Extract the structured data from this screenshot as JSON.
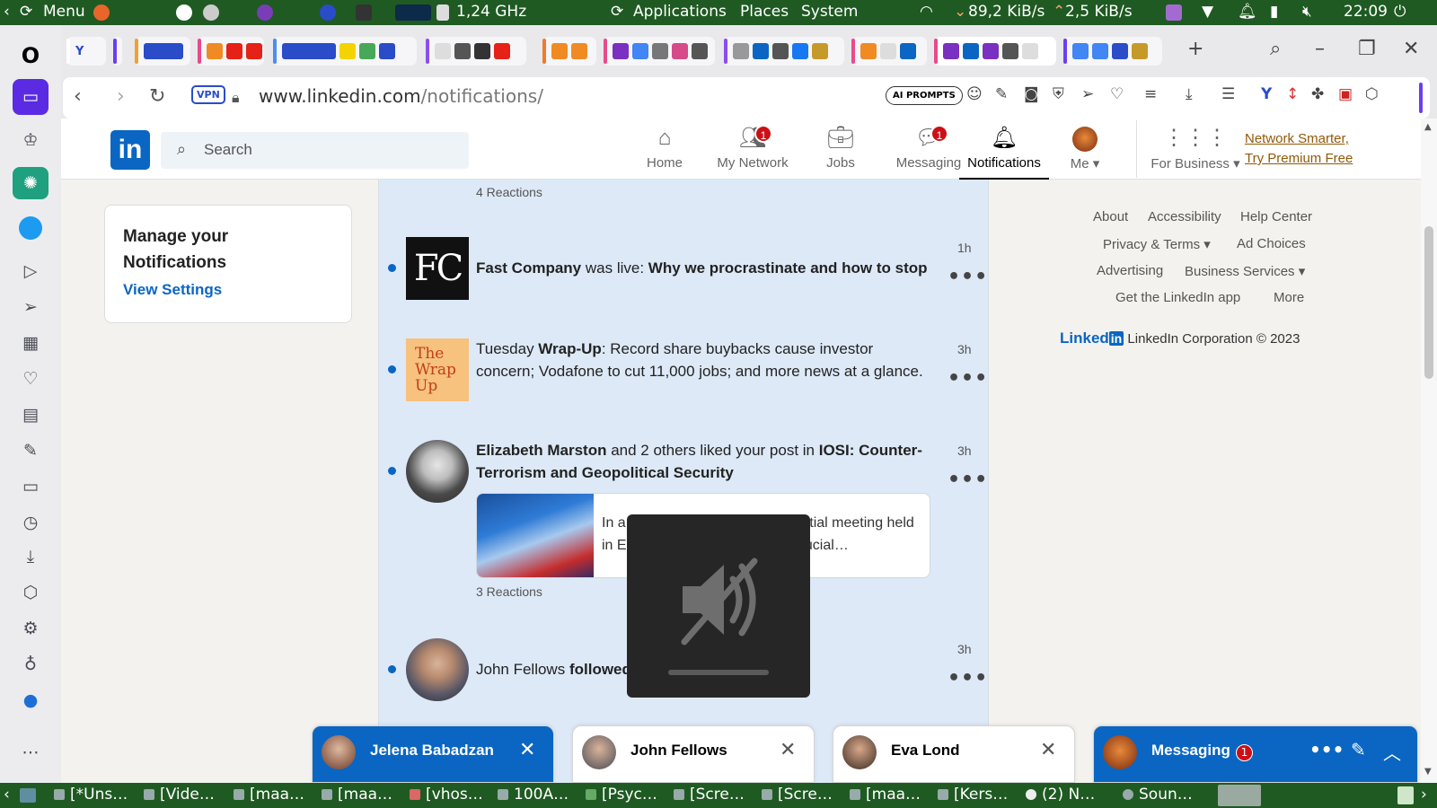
{
  "system_bar": {
    "menu_label": "Menu",
    "cpu_freq": "1,24 GHz",
    "applications": "Applications",
    "places": "Places",
    "system": "System",
    "net_down": "89,2 KiB/s",
    "net_up": "2,5 KiB/s",
    "clock": "22:09"
  },
  "browser": {
    "vpn_label": "VPN",
    "url_host": "www.linkedin.com",
    "url_path": "/notifications/",
    "ai_prompts_label": "AI PROMPTS"
  },
  "linkedin": {
    "logo": "in",
    "search_placeholder": "Search",
    "nav": {
      "home": "Home",
      "network": "My Network",
      "network_badge": "1",
      "jobs": "Jobs",
      "messaging": "Messaging",
      "messaging_badge": "1",
      "notifications": "Notifications",
      "me": "Me",
      "business": "For Business"
    },
    "premium": {
      "line1": "Network Smarter,",
      "line2": "Try Premium Free"
    },
    "manage_card": {
      "title": "Manage your Notifications",
      "link": "View Settings"
    },
    "notifications": {
      "top_reactions": "4 Reactions",
      "items": [
        {
          "actor": "Fast Company",
          "middle": " was live: ",
          "bold_end": "Why we procrastinate and how to stop",
          "time": "1h",
          "thumb_text": "FC"
        },
        {
          "prefix": "Tuesday ",
          "bold": "Wrap-Up",
          "rest": ": Record share buybacks cause investor concern; Vodafone to cut 11,000 jobs; and more news at a glance.",
          "time": "3h",
          "thumb_text": "The Wrap Up"
        },
        {
          "actor": "Elizabeth Marston",
          "middle": " and 2 others liked your post in ",
          "bold_end": "IOSI: Counter-Terrorism and Geopolitical Security",
          "time": "3h",
          "post_snippet": "In a highly significant and influential meeting held in Estonia, we delved into the crucial…",
          "reactions": "3 Reactions"
        },
        {
          "actor": "John Fellows",
          "middle": " ",
          "bold_end": "followed you",
          "time": "3h"
        }
      ]
    },
    "footer": {
      "about": "About",
      "accessibility": "Accessibility",
      "help": "Help Center",
      "privacy": "Privacy & Terms",
      "ad_choices": "Ad Choices",
      "advertising": "Advertising",
      "business_services": "Business Services",
      "get_app": "Get the LinkedIn app",
      "more": "More",
      "brand": "Linked",
      "brand_in": "in",
      "copyright": "LinkedIn Corporation © 2023"
    },
    "dock": {
      "chat1": "Jelena Babadzan",
      "chat2": "John Fellows",
      "chat3": "Eva Lond",
      "messaging": "Messaging",
      "messaging_badge": "1"
    }
  },
  "taskbar": {
    "tasks": [
      "[*Uns…",
      "[Vide…",
      "[maa…",
      "[maa…",
      "[vhos…",
      "100A…",
      "[Psyc…",
      "[Scre…",
      "[Scre…",
      "[maa…",
      "[Kers…",
      "(2) N…",
      "Soun…"
    ]
  },
  "colors": {
    "panel_green": "#1f5a22",
    "linkedin_blue": "#0a66c2",
    "feed_unread_bg": "#dde9f7",
    "badge_red": "#cc1016",
    "premium_gold": "#915907"
  }
}
